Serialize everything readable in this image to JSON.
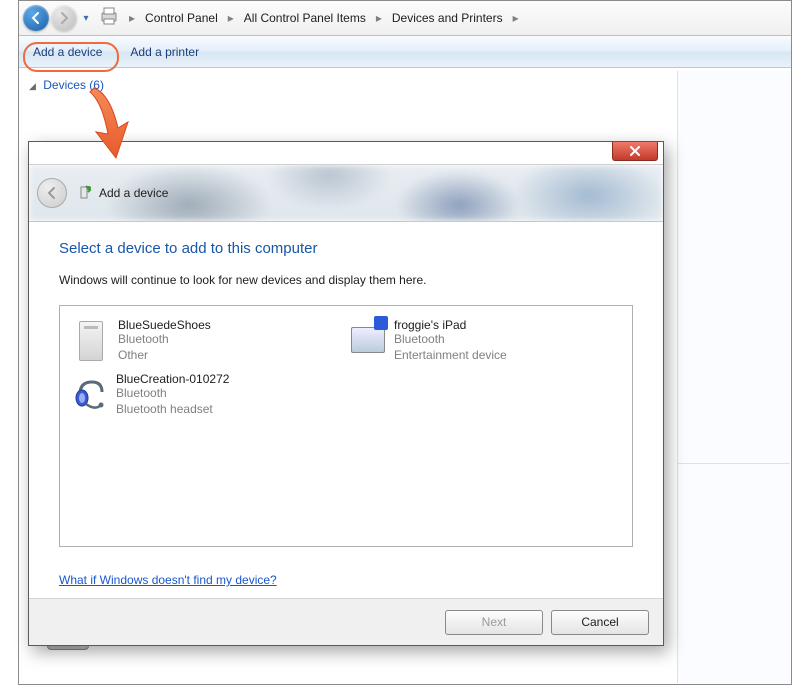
{
  "breadcrumbs": [
    "Control Panel",
    "All Control Panel Items",
    "Devices and Printers"
  ],
  "commands": {
    "add_device": "Add a device",
    "add_printer": "Add a printer"
  },
  "category": {
    "name": "Devices",
    "count": "(6)"
  },
  "dialog": {
    "title": "Add a device",
    "heading": "Select a device to add to this computer",
    "subtext": "Windows will continue to look for new devices and display them here.",
    "devices": [
      {
        "name": "BlueSuedeShoes",
        "type": "Bluetooth",
        "sub": "Other",
        "icon": "tower"
      },
      {
        "name": "froggie's iPad",
        "type": "Bluetooth",
        "sub": "Entertainment device",
        "icon": "monitor"
      },
      {
        "name": "BlueCreation-010272",
        "type": "Bluetooth",
        "sub": "Bluetooth headset",
        "icon": "headset"
      }
    ],
    "help_link": "What if Windows doesn't find my device?",
    "next": "Next",
    "cancel": "Cancel"
  }
}
